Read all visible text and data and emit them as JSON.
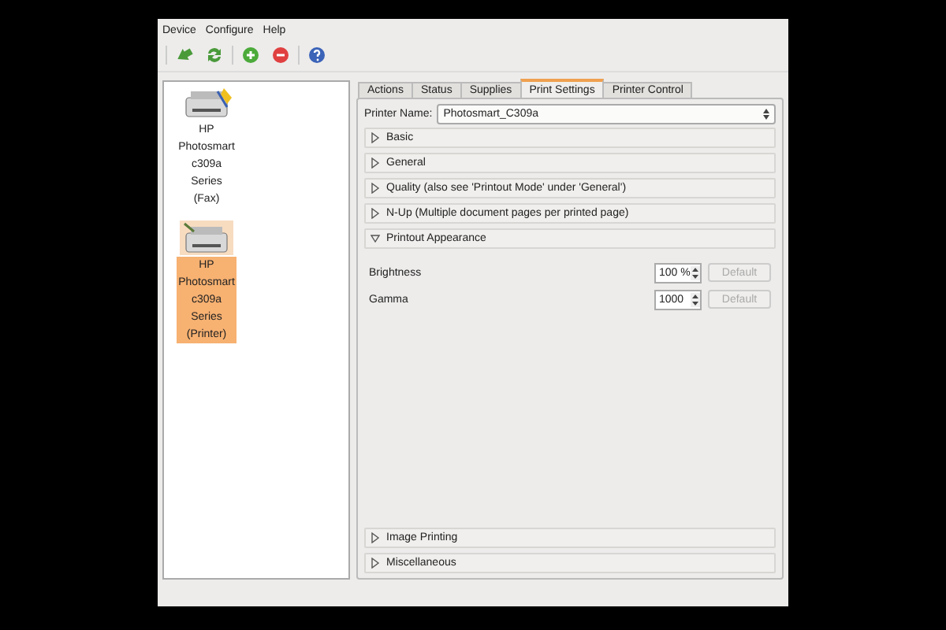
{
  "menu": [
    "Device",
    "Configure",
    "Help"
  ],
  "devices": [
    {
      "name": "HP Photosmart c309a Series (Fax)",
      "kind": "fax",
      "selected": false
    },
    {
      "name": "HP Photosmart c309a Series (Printer)",
      "kind": "printer",
      "selected": true
    }
  ],
  "tabs": [
    {
      "label": "Actions",
      "selected": false
    },
    {
      "label": "Status",
      "selected": false
    },
    {
      "label": "Supplies",
      "selected": false
    },
    {
      "label": "Print Settings",
      "selected": true
    },
    {
      "label": "Printer Control",
      "selected": false
    }
  ],
  "printer_name": {
    "label": "Printer Name:",
    "value": "Photosmart_C309a"
  },
  "sections": [
    {
      "title": "Basic",
      "expanded": false
    },
    {
      "title": "General",
      "expanded": false
    },
    {
      "title": "Quality (also see 'Printout Mode' under 'General')",
      "expanded": false
    },
    {
      "title": "N-Up (Multiple document pages per printed page)",
      "expanded": false
    },
    {
      "title": "Printout Appearance",
      "expanded": true,
      "options": [
        {
          "label": "Brightness",
          "value": "100 %",
          "button": "Default",
          "disabled": true
        },
        {
          "label": "Gamma",
          "value": "1000",
          "button": "Default",
          "disabled": true
        }
      ]
    },
    {
      "title": "Image Printing",
      "expanded": false
    },
    {
      "title": "Miscellaneous",
      "expanded": false
    }
  ]
}
